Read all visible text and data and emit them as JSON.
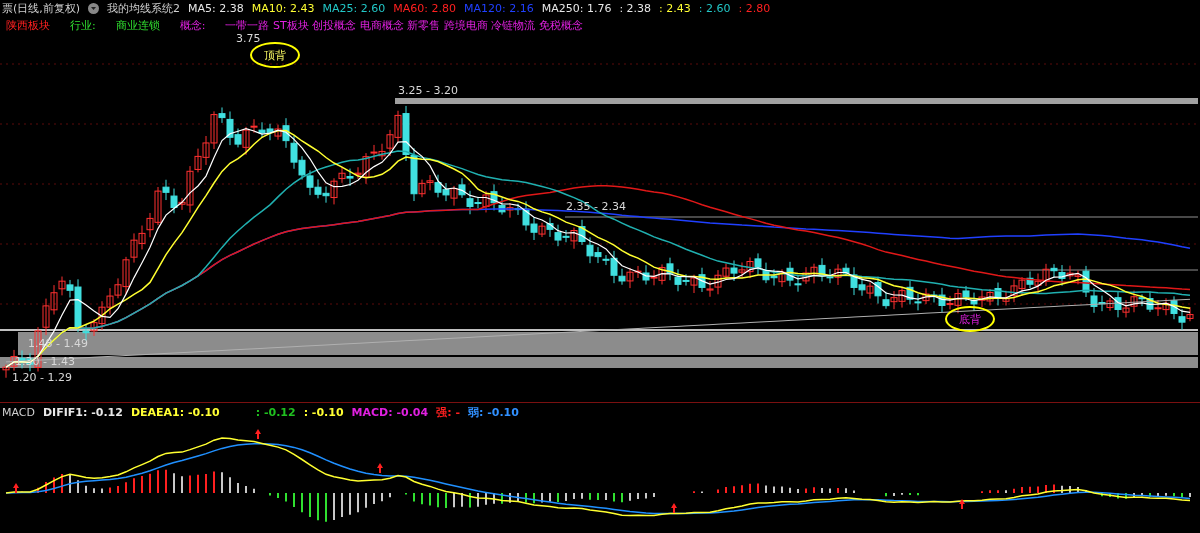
{
  "header": {
    "title": "票(日线,前复权)",
    "indicator": "我的均线系统2",
    "ma_values": [
      {
        "label": "MA5: 2.38",
        "color": "#e8e8e8"
      },
      {
        "label": "MA10: 2.43",
        "color": "#ffff33"
      },
      {
        "label": "MA25: 2.60",
        "color": "#22c8c8"
      },
      {
        "label": "MA60: 2.80",
        "color": "#ff2020"
      },
      {
        "label": "MA120: 2.16",
        "color": "#2040ff"
      },
      {
        "label": "MA250: 1.76",
        "color": "#e8e8e8"
      },
      {
        "label": ": 2.38",
        "color": "#e8e8e8"
      },
      {
        "label": ": 2.43",
        "color": "#ffff33"
      },
      {
        "label": ": 2.60",
        "color": "#22c8c8"
      },
      {
        "label": ": 2.80",
        "color": "#ff2020"
      }
    ]
  },
  "info_row": {
    "region": "陕西板块",
    "industry_label": "行业:",
    "industry": "商业连锁",
    "concept_label": "概念:",
    "concepts": "一带一路 ST板块 创投概念 电商概念 新零售 跨境电商 冷链物流 免税概念"
  },
  "price_labels": [
    "3.75",
    "3.25 - 3.20",
    "2.35 - 2.34",
    "1.48 - 1.49",
    "1.30 - 1.43",
    "1.20 - 1.29"
  ],
  "annotations": [
    {
      "text": "顶背",
      "kind": "top"
    },
    {
      "text": "底背",
      "kind": "bottom"
    }
  ],
  "macd": {
    "title": "MACD",
    "items": [
      {
        "label": "DIFIF1: -0.12",
        "color": "#e8e8e8"
      },
      {
        "label": "DEAEA1: -0.10",
        "color": "#ffff33"
      },
      {
        "label": ": -0.12",
        "color": "#20c020"
      },
      {
        "label": ": -0.10",
        "color": "#ffff33"
      },
      {
        "label": "MACD: -0.04",
        "color": "#e020e0"
      },
      {
        "label": "强: -",
        "color": "#ff2020"
      },
      {
        "label": "弱: -0.10",
        "color": "#3090ff"
      }
    ]
  }
}
